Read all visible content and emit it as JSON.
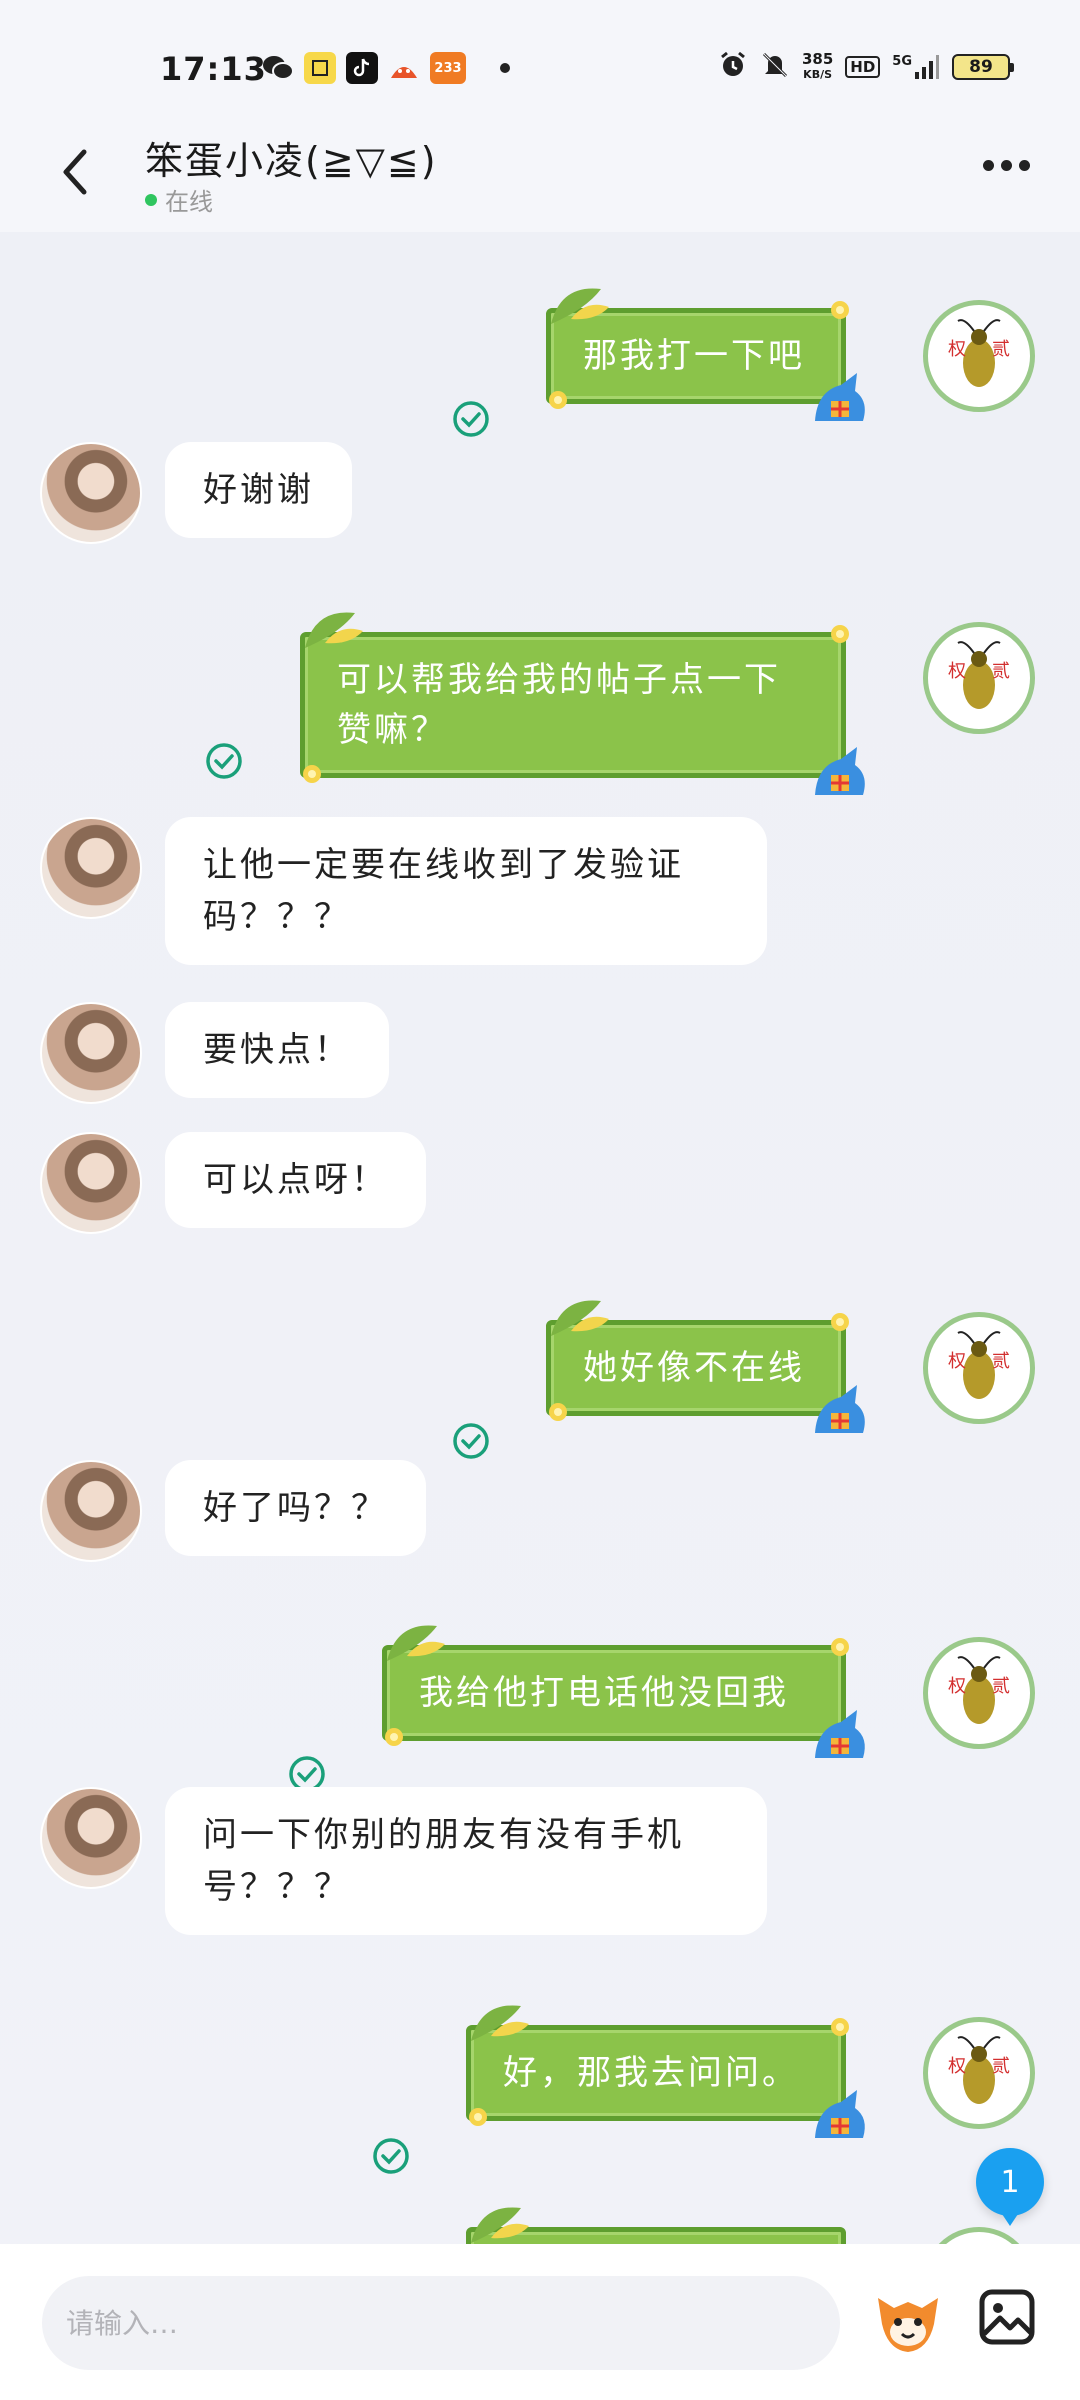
{
  "status_bar": {
    "time": "17:13",
    "speed_value": "385",
    "speed_unit": "KB/S",
    "hd": "HD",
    "network": "5G",
    "battery": "89",
    "app_badge": "233"
  },
  "header": {
    "title": "笨蛋小凌(≧▽≦)",
    "status": "在线"
  },
  "messages": [
    {
      "side": "right",
      "text": "那我打一下吧"
    },
    {
      "side": "left",
      "text": "好谢谢"
    },
    {
      "side": "right",
      "text": "可以帮我给我的帖子点一下赞嘛？"
    },
    {
      "side": "left",
      "text": "让他一定要在线收到了发验证码？？？"
    },
    {
      "side": "left",
      "text": "要快点！"
    },
    {
      "side": "left",
      "text": "可以点呀！"
    },
    {
      "side": "right",
      "text": "她好像不在线"
    },
    {
      "side": "left",
      "text": "好了吗？？"
    },
    {
      "side": "right",
      "text": "我给他打电话他没回我"
    },
    {
      "side": "left",
      "text": "问一下你别的朋友有没有手机号？？？"
    },
    {
      "side": "right",
      "text": "好，那我去问问。"
    }
  ],
  "unread_badge": "1",
  "input": {
    "placeholder": "请输入…"
  },
  "colors": {
    "bubble_green": "#8bc34a",
    "check_green": "#1aa07a",
    "online_dot": "#2fc55f",
    "badge_blue": "#1aa0f0"
  }
}
